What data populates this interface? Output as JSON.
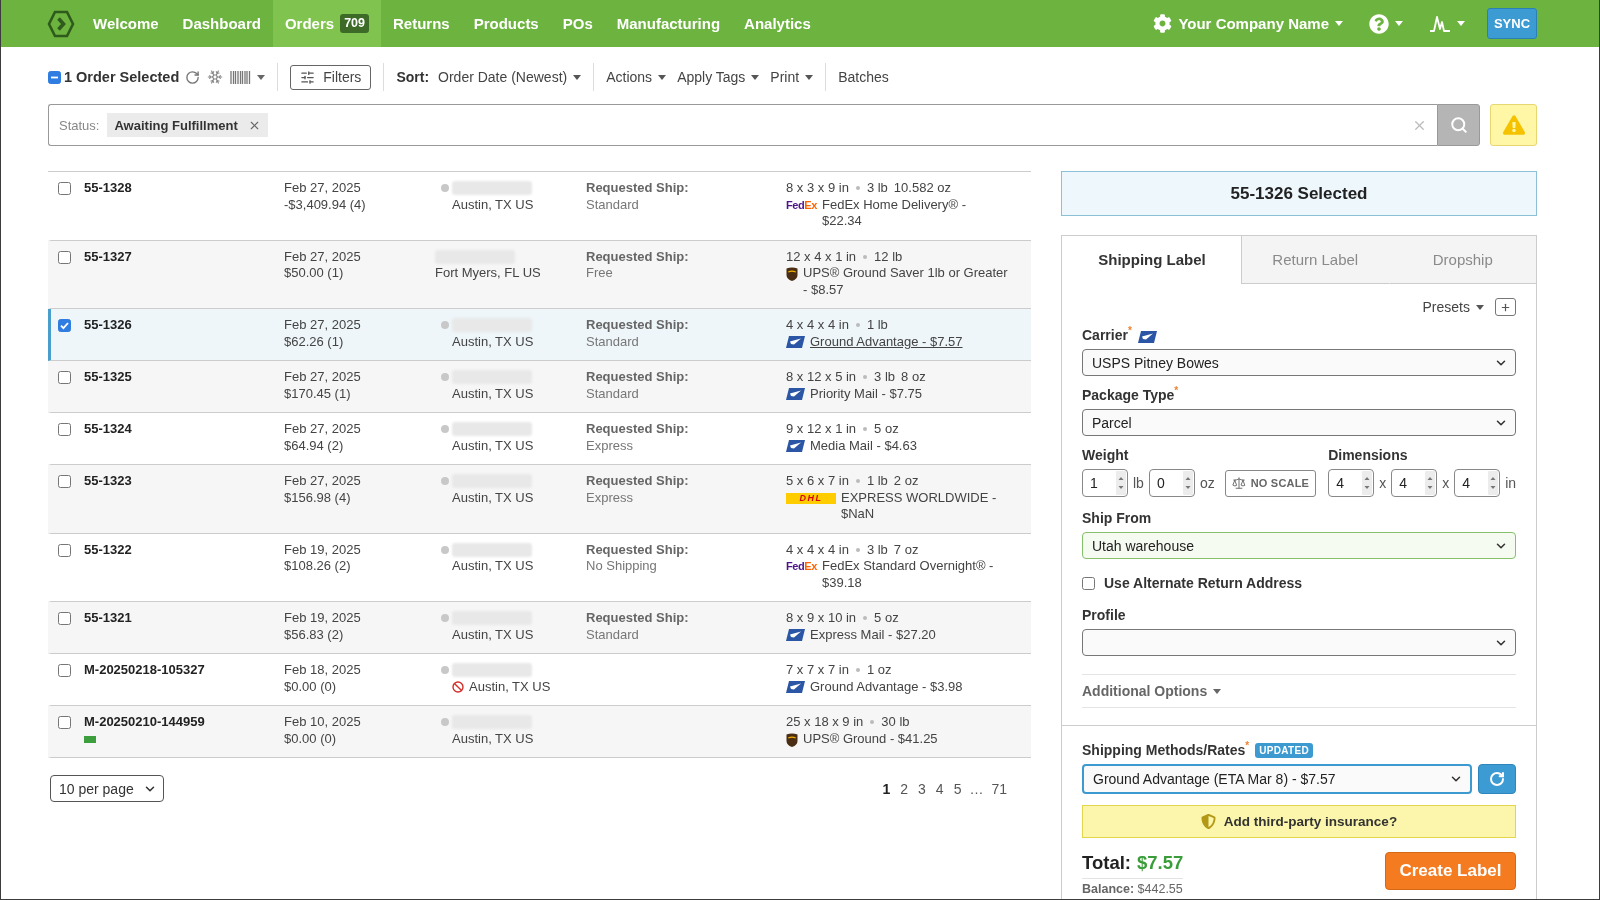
{
  "nav": {
    "items": [
      {
        "label": "Welcome",
        "selected": false
      },
      {
        "label": "Dashboard",
        "selected": false
      },
      {
        "label": "Orders",
        "badge": "709",
        "selected": true
      },
      {
        "label": "Returns",
        "selected": false
      },
      {
        "label": "Products",
        "selected": false
      },
      {
        "label": "POs",
        "selected": false
      },
      {
        "label": "Manufacturing",
        "selected": false
      },
      {
        "label": "Analytics",
        "selected": false
      }
    ],
    "company": "Your Company Name",
    "sync": "SYNC"
  },
  "toolbar": {
    "selection": {
      "label": "1 Order Selected",
      "indeterminate": true
    },
    "filters": "Filters",
    "sort": {
      "label": "Sort:",
      "value": "Order Date (Newest)"
    },
    "menus": [
      "Actions",
      "Apply Tags",
      "Print"
    ],
    "batches": "Batches"
  },
  "search": {
    "label": "Status:",
    "chips": [
      "Awaiting Fulfillment"
    ]
  },
  "orders": [
    {
      "id": "55-1328",
      "selected": false,
      "date": "Feb 27, 2025",
      "amount": "-$3,409.94 (4)",
      "status_dot": true,
      "address_flag": false,
      "city": "Austin, TX US",
      "requested": {
        "label": "Requested Ship:",
        "value": "Standard"
      },
      "dimensions": "8 x 3 x 9 in",
      "weight": [
        "3 lb",
        "10.582 oz"
      ],
      "carrier": {
        "kind": "fedex",
        "logo": [
          "Fed",
          "Ex"
        ]
      },
      "service": "FedEx Home Delivery® - $22.34",
      "service_link": false
    },
    {
      "id": "55-1327",
      "selected": false,
      "date": "Feb 27, 2025",
      "amount": "$50.00 (1)",
      "status_dot": false,
      "address_flag": false,
      "city": "Fort Myers, FL US",
      "requested": {
        "label": "Requested Ship:",
        "value": "Free"
      },
      "dimensions": "12 x 4 x 1 in",
      "weight": [
        "12 lb"
      ],
      "carrier": {
        "kind": "ups"
      },
      "service": "UPS® Ground Saver 1lb or Greater - $8.57",
      "service_link": false
    },
    {
      "id": "55-1326",
      "selected": true,
      "date": "Feb 27, 2025",
      "amount": "$62.26 (1)",
      "status_dot": true,
      "address_flag": false,
      "city": "Austin, TX US",
      "requested": {
        "label": "Requested Ship:",
        "value": "Standard"
      },
      "dimensions": "4 x 4 x 4 in",
      "weight": [
        "1 lb"
      ],
      "carrier": {
        "kind": "usps"
      },
      "service": "Ground Advantage - $7.57",
      "service_link": true
    },
    {
      "id": "55-1325",
      "selected": false,
      "date": "Feb 27, 2025",
      "amount": "$170.45 (1)",
      "status_dot": true,
      "address_flag": false,
      "city": "Austin, TX US",
      "requested": {
        "label": "Requested Ship:",
        "value": "Standard"
      },
      "dimensions": "8 x 12 x 5 in",
      "weight": [
        "3 lb",
        "8 oz"
      ],
      "carrier": {
        "kind": "usps"
      },
      "service": "Priority Mail - $7.75",
      "service_link": false
    },
    {
      "id": "55-1324",
      "selected": false,
      "date": "Feb 27, 2025",
      "amount": "$64.94 (2)",
      "status_dot": true,
      "address_flag": false,
      "city": "Austin, TX US",
      "requested": {
        "label": "Requested Ship:",
        "value": "Express"
      },
      "dimensions": "9 x 12 x 1 in",
      "weight": [
        "5 oz"
      ],
      "carrier": {
        "kind": "usps"
      },
      "service": "Media Mail - $4.63",
      "service_link": false
    },
    {
      "id": "55-1323",
      "selected": false,
      "date": "Feb 27, 2025",
      "amount": "$156.98 (4)",
      "status_dot": true,
      "address_flag": false,
      "city": "Austin, TX US",
      "requested": {
        "label": "Requested Ship:",
        "value": "Express"
      },
      "dimensions": "5 x 6 x 7 in",
      "weight": [
        "1 lb",
        "2 oz"
      ],
      "carrier": {
        "kind": "dhl",
        "logo": [
          "DHL"
        ]
      },
      "service": "EXPRESS WORLDWIDE - $NaN",
      "service_link": false
    },
    {
      "id": "55-1322",
      "selected": false,
      "date": "Feb 19, 2025",
      "amount": "$108.26 (2)",
      "status_dot": true,
      "address_flag": false,
      "city": "Austin, TX US",
      "requested": {
        "label": "Requested Ship:",
        "value": "No Shipping"
      },
      "dimensions": "4 x 4 x 4 in",
      "weight": [
        "3 lb",
        "7 oz"
      ],
      "carrier": {
        "kind": "fedex",
        "logo": [
          "Fed",
          "Ex"
        ]
      },
      "service": "FedEx Standard Overnight® - $39.18",
      "service_link": false
    },
    {
      "id": "55-1321",
      "selected": false,
      "date": "Feb 19, 2025",
      "amount": "$56.83 (2)",
      "status_dot": true,
      "address_flag": false,
      "city": "Austin, TX US",
      "requested": {
        "label": "Requested Ship:",
        "value": "Standard"
      },
      "dimensions": "8 x 9 x 10 in",
      "weight": [
        "5 oz"
      ],
      "carrier": {
        "kind": "usps"
      },
      "service": "Express Mail - $27.20",
      "service_link": false
    },
    {
      "id": "M-20250218-105327",
      "selected": false,
      "date": "Feb 18, 2025",
      "amount": "$0.00 (0)",
      "status_dot": true,
      "address_flag": true,
      "city": "Austin, TX US",
      "dimensions": "7 x 7 x 7 in",
      "weight": [
        "1 oz"
      ],
      "carrier": {
        "kind": "usps"
      },
      "service": "Ground Advantage - $3.98",
      "service_link": false
    },
    {
      "id": "M-20250210-144959",
      "selected": false,
      "tags": [
        {
          "color": "#3c9e3c"
        }
      ],
      "date": "Feb 10, 2025",
      "amount": "$0.00 (0)",
      "status_dot": true,
      "address_flag": false,
      "city": "Austin, TX US",
      "dimensions": "25 x 18 x 9 in",
      "weight": [
        "30 lb"
      ],
      "carrier": {
        "kind": "ups"
      },
      "service": "UPS® Ground - $41.25",
      "service_link": false
    }
  ],
  "pagination": {
    "per_page": "10 per page",
    "pages": [
      {
        "kind": "page",
        "label": "1",
        "selected": true
      },
      {
        "kind": "page",
        "label": "2",
        "selected": false
      },
      {
        "kind": "page",
        "label": "3",
        "selected": false
      },
      {
        "kind": "page",
        "label": "4",
        "selected": false
      },
      {
        "kind": "page",
        "label": "5",
        "selected": false
      },
      {
        "kind": "gap",
        "label": "…"
      },
      {
        "kind": "page",
        "label": "71",
        "selected": false
      }
    ]
  },
  "panel": {
    "heading": "55-1326 Selected",
    "tabs": [
      {
        "label": "Shipping Label",
        "selected": true
      },
      {
        "label": "Return Label",
        "selected": false
      },
      {
        "label": "Dropship",
        "selected": false
      }
    ],
    "presets": "Presets",
    "carrier": {
      "label": "Carrier$^{*}$",
      "kind": "usps",
      "value": "USPS Pitney Bowes"
    },
    "package_type": {
      "label": "Package Type$^{*}$",
      "value": "Parcel"
    },
    "weight": {
      "label": "Weight",
      "fields": [
        {
          "value": "1",
          "unit": "lb"
        },
        {
          "value": "0",
          "unit": "oz"
        }
      ],
      "scale": "NO SCALE"
    },
    "dimensions": {
      "label": "Dimensions",
      "fields": [
        {
          "value": "4",
          "unit": "x"
        },
        {
          "value": "4",
          "unit": "x"
        },
        {
          "value": "4",
          "unit": "in"
        }
      ]
    },
    "ship_from": {
      "label": "Ship From",
      "value": "Utah warehouse",
      "validated": true
    },
    "alternate_return": {
      "label": "Use Alternate Return Address",
      "checked": false
    },
    "profile": {
      "label": "Profile"
    },
    "additional": "Additional Options",
    "rates": {
      "label": "Shipping Methods/Rates$^{*}$",
      "badge": "UPDATED",
      "value": "Ground Advantage (ETA Mar 8) - $7.57",
      "focused": true
    },
    "insurance": "Add third-party insurance?",
    "total": {
      "label": "Total:",
      "amount": "$7.57"
    },
    "balance": "**Balance:** $442.55",
    "create": "Create Label"
  }
}
